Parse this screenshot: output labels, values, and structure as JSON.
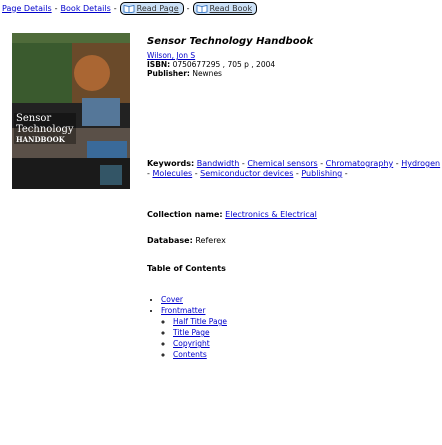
{
  "breadcrumb": {
    "page_details": "Page Details",
    "sep": "-",
    "book_details": "Book Details",
    "read_page_label": "Read Page",
    "read_book_label": "Read Book"
  },
  "book": {
    "title": "Sensor Technology Handbook",
    "author": "Wilson, Jon S",
    "isbn_label": "ISBN:",
    "isbn_value": "0750677295 , 705 p , 2004",
    "publisher_label": "Publisher:",
    "publisher_value": "Newnes",
    "cover_text": [
      "Sensor",
      "Technology",
      "HANDBOOK"
    ]
  },
  "keywords": {
    "label": "Keywords:",
    "items": [
      "Bandwidth",
      "Chemical sensors",
      "Chromatography",
      "Hydrogen",
      "Molecules",
      "Semiconductor devices",
      "Publishing"
    ]
  },
  "collection": {
    "label": "Collection name:",
    "value": "Electronics & Electrical"
  },
  "database": {
    "label": "Database:",
    "value": "Referex"
  },
  "toc": {
    "title": "Table of Contents",
    "items": [
      {
        "label": "Cover",
        "children": []
      },
      {
        "label": "Frontmatter",
        "children": [
          "Half Title Page",
          "Title Page",
          "Copyright",
          "Contents"
        ]
      }
    ]
  },
  "colors": {
    "link": "#0000cc",
    "button_bg": "#cde2f8"
  }
}
